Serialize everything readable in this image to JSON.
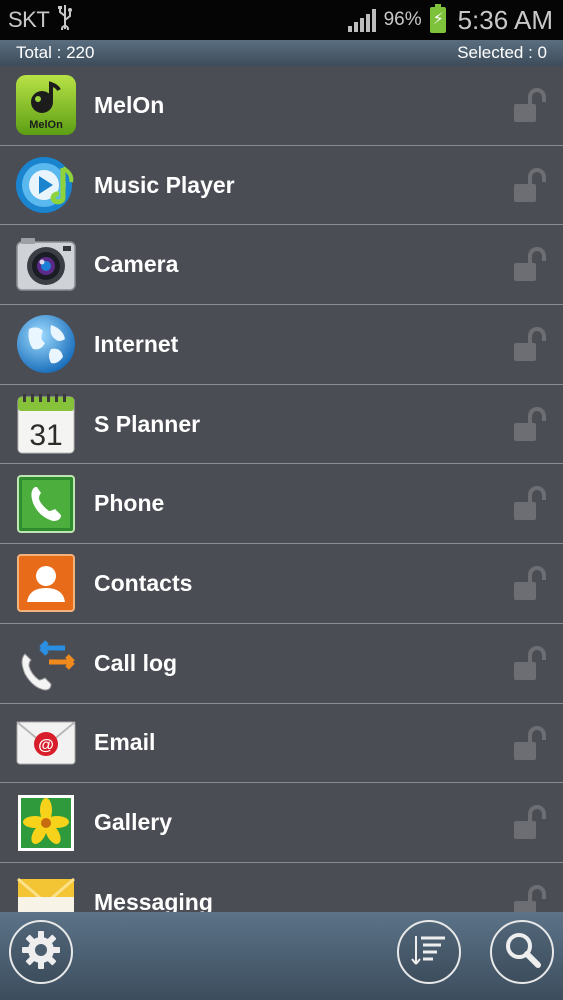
{
  "status_bar": {
    "carrier": "SKT",
    "battery_percent": "96%",
    "time": "5:36 AM",
    "icons": [
      "usb-icon",
      "signal-icon",
      "battery-charging-icon"
    ]
  },
  "header": {
    "total_label": "Total : 220",
    "selected_label": "Selected : 0"
  },
  "apps": [
    {
      "name": "MelOn",
      "icon": "melon-icon",
      "icon_text": "MelOn",
      "locked": false
    },
    {
      "name": "Music Player",
      "icon": "music-player-icon",
      "locked": false
    },
    {
      "name": "Camera",
      "icon": "camera-icon",
      "locked": false
    },
    {
      "name": "Internet",
      "icon": "internet-icon",
      "locked": false
    },
    {
      "name": "S Planner",
      "icon": "calendar-icon",
      "icon_text": "31",
      "locked": false
    },
    {
      "name": "Phone",
      "icon": "phone-icon",
      "locked": false
    },
    {
      "name": "Contacts",
      "icon": "contacts-icon",
      "locked": false
    },
    {
      "name": "Call log",
      "icon": "call-log-icon",
      "locked": false
    },
    {
      "name": "Email",
      "icon": "email-icon",
      "locked": false
    },
    {
      "name": "Gallery",
      "icon": "gallery-icon",
      "locked": false
    },
    {
      "name": "Messaging",
      "icon": "messaging-icon",
      "locked": false
    }
  ],
  "bottom_bar": {
    "buttons": [
      "settings-icon",
      "sort-icon",
      "search-icon"
    ]
  },
  "colors": {
    "list_background": "#4b4d55",
    "header_gradient_top": "#5a6e80",
    "battery_green": "#7ec13b"
  }
}
